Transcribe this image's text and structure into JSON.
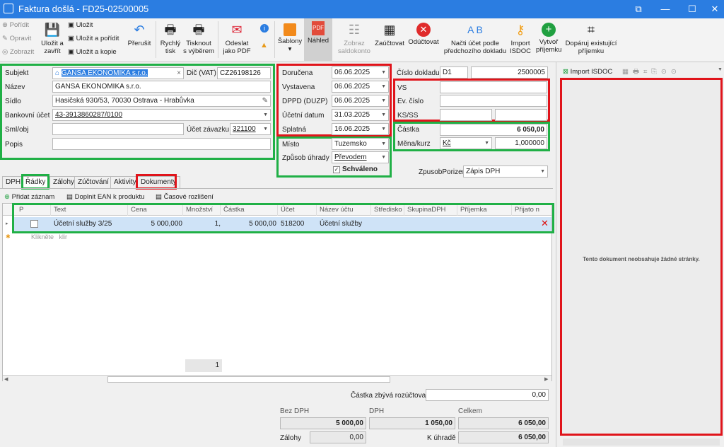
{
  "window": {
    "title": "Faktura došlá - FD25-02500005",
    "buttons": [
      "⧉",
      "—",
      "☐",
      "✕"
    ]
  },
  "ribbon": {
    "small_left": [
      {
        "label": "Pořídit",
        "dim": true,
        "icon": "plus-icon"
      },
      {
        "label": "Opravit",
        "dim": true,
        "icon": "pencil-icon"
      },
      {
        "label": "Zobrazit",
        "dim": true,
        "icon": "eye-icon"
      }
    ],
    "save_close": "Uložit a\nzavřít",
    "small_save": [
      {
        "label": "Uložit",
        "icon": "save-icon"
      },
      {
        "label": "Uložit a pořídit",
        "icon": "save-new-icon"
      },
      {
        "label": "Uložit a kopie",
        "icon": "save-copy-icon"
      }
    ],
    "buttons": [
      {
        "label": "Přerušit",
        "icon": "undo-icon"
      },
      {
        "label": "Rychlý\ntisk",
        "icon": "printer-icon"
      },
      {
        "label": "Tisknout\ns výběrem",
        "icon": "printer-select-icon"
      },
      {
        "label": "Odeslat\njako PDF",
        "icon": "pdf-mail-icon"
      },
      {
        "label": "Šablony\n▾",
        "icon": "template-icon"
      },
      {
        "label": "Náhled",
        "icon": "pdf-preview-icon"
      },
      {
        "label": "Zobraz\nsaldokonto",
        "icon": "ledger-icon"
      },
      {
        "label": "Zaúčtovat",
        "icon": "calculator-icon"
      },
      {
        "label": "Odúčtovat",
        "icon": "cancel-icon"
      },
      {
        "label": "Načti účet podle\npředchozího dokladu",
        "icon": "ab-icon"
      },
      {
        "label": "Import\nISDOC",
        "icon": "key-icon"
      },
      {
        "label": "Vytvoř\npříjemku",
        "icon": "add-circle-icon"
      },
      {
        "label": "Dopáruj existující\npříjemku",
        "icon": "binoculars-icon"
      }
    ]
  },
  "subject": {
    "subjekt_label": "Subjekt",
    "subjekt_value": "GANSA EKONOMIKA s.r.o.",
    "dic_label": "Dič (VAT)",
    "dic_value": "CZ26198126",
    "nazev_label": "Název",
    "nazev_value": "GANSA EKONOMIKA s.r.o.",
    "sidlo_label": "Sídlo",
    "sidlo_value": "Hasičská 930/53, 70030 Ostrava - Hrabůvka",
    "ucet_label": "Bankovní účet",
    "ucet_value": "43-3913860287/0100",
    "smlobj_label": "Sml/obj",
    "ucet_zav_label": "Účet závazku",
    "ucet_zav_value": "321100",
    "popis_label": "Popis"
  },
  "dates": {
    "dorucena_label": "Doručena",
    "dorucena": "06.06.2025",
    "vystavena_label": "Vystavena",
    "vystavena": "06.06.2025",
    "dppd_label": "DPPD (DUZP)",
    "dppd": "06.06.2025",
    "ucetni_label": "Účetní datum",
    "ucetni": "31.03.2025",
    "splatna_label": "Splatná",
    "splatna": "16.06.2025"
  },
  "place": {
    "misto_label": "Místo",
    "misto": "Tuzemsko",
    "uhrada_label": "Způsob úhrady",
    "uhrada": "Převodem",
    "schvaleno": "Schváleno"
  },
  "doc": {
    "cislo_label": "Číslo dokladu",
    "cislo_series": "D1",
    "cislo_value": "2500005",
    "vs_label": "VS",
    "ev_label": "Ev. číslo",
    "ksss_label": "KS/SS",
    "castka_label": "Částka",
    "castka_value": "6 050,00",
    "mena_label": "Měna/kurz",
    "mena_value": "Kč",
    "kurz_value": "1,000000",
    "porizeni_label": "ZpusobPorizeni",
    "porizeni_value": "Zápis DPH"
  },
  "tabs": [
    "DPH",
    "Řádky",
    "Zálohy",
    "Zúčtování",
    "Aktivity",
    "Dokumenty"
  ],
  "grid_toolbar": [
    "Přidat záznam",
    "Doplnit EAN k produktu",
    "Časové rozlišení"
  ],
  "grid": {
    "headers": [
      "P",
      "Text",
      "Cena",
      "Množství",
      "Částka",
      "Účet",
      "Název účtu",
      "Středisko",
      "SkupinaDPH",
      "Příjemka",
      "Přijato n"
    ],
    "row": {
      "text": "Účetní služby 3/25",
      "cena": "5 000,000",
      "mnozstvi": "1,",
      "castka": "5 000,00",
      "ucet": "518200",
      "nazev": "Účetní služby"
    },
    "newrow_hint": "Klikněte   klir",
    "count": "1"
  },
  "totals": {
    "rozuctovat_label": "Částka zbývá rozúčtovat",
    "rozuctovat_value": "0,00",
    "bez_dph_label": "Bez DPH",
    "dph_label": "DPH",
    "celkem_label": "Celkem",
    "bez_dph": "5 000,00",
    "dph": "1 050,00",
    "celkem": "6 050,00",
    "zalohy_label": "Zálohy",
    "zalohy": "0,00",
    "k_uhrade_label": "K úhradě",
    "k_uhrade": "6 050,00"
  },
  "right": {
    "import_label": "Import ISDOC",
    "empty_text": "Tento dokument neobsahuje žádné stránky."
  },
  "colors": {
    "accent": "#2b7de1",
    "red_box": "#e0141b",
    "green_box": "#20b046",
    "selected_row": "#cfe3f7"
  }
}
